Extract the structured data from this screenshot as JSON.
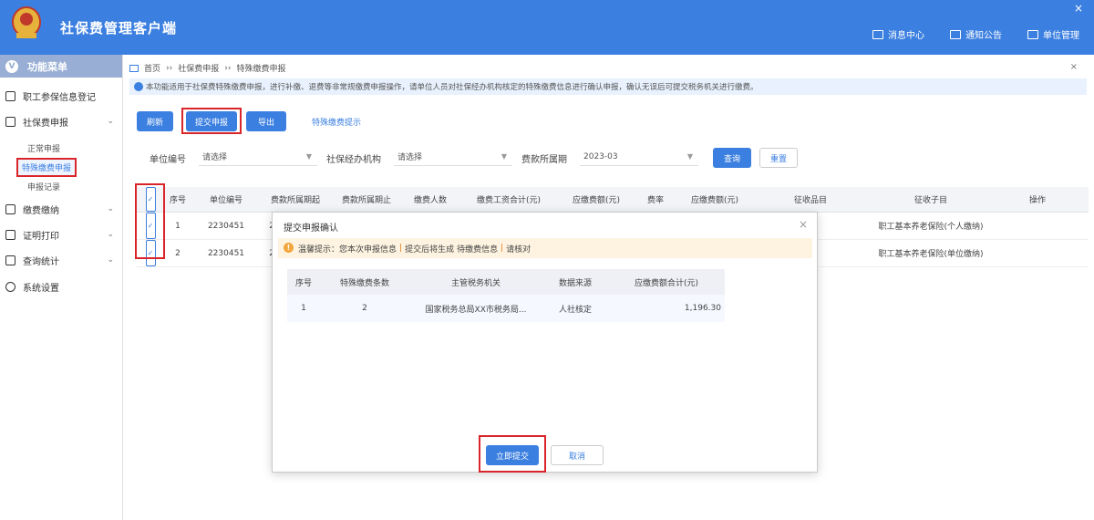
{
  "header": {
    "app_title": "社保费管理客户端",
    "actions": [
      {
        "label": "消息中心",
        "icon": "bell-icon"
      },
      {
        "label": "通知公告",
        "icon": "notice-icon"
      },
      {
        "label": "单位管理",
        "icon": "building-icon"
      }
    ],
    "close_symbol": "×"
  },
  "sidebar": {
    "title": "功能菜单",
    "items": [
      {
        "label": "职工参保信息登记",
        "icon": "register-icon"
      },
      {
        "label": "社保费申报",
        "icon": "declare-icon",
        "expanded": true
      },
      {
        "label": "缴费缴纳",
        "icon": "pay-icon"
      },
      {
        "label": "证明打印",
        "icon": "print-icon"
      },
      {
        "label": "查询统计",
        "icon": "stats-icon"
      },
      {
        "label": "系统设置",
        "icon": "gear-icon"
      }
    ],
    "sub_items": [
      "正常申报",
      "特殊缴费申报",
      "申报记录"
    ],
    "active_sub": "特殊缴费申报"
  },
  "breadcrumb": {
    "home": "首页",
    "level1": "社保费申报",
    "level2": "特殊缴费申报"
  },
  "notice_text": "本功能适用于社保费特殊缴费申报，进行补缴、退费等非常规缴费申报操作，请单位人员对社保经办机构核定的特殊缴费信息进行确认申报，确认无误后可提交税务机关进行缴费。",
  "toolbar": {
    "refresh_label": "刷新",
    "batch_label": "提交申报",
    "export_label": "导出",
    "link_label": "特殊缴费提示"
  },
  "filters": {
    "unit_label": "单位编号",
    "unit_value": "请选择",
    "agency_label": "社保经办机构",
    "agency_value": "请选择",
    "period_label": "费款所属期",
    "period_value": "2023-03",
    "query_label": "查询",
    "reset_label": "重置"
  },
  "grid": {
    "headers": [
      "序号",
      "单位编号",
      "费款所属期起",
      "费款所属期止",
      "缴费人数",
      "缴费工资合计(元)",
      "应缴费额(元)",
      "费率",
      "应缴费额(元)",
      "征收品目",
      "征收子目",
      "操作"
    ],
    "rows": [
      {
        "index": "1",
        "unit_no": "2230451",
        "unit_tail": "20",
        "item": "职工基本养老保险(个人缴纳)"
      },
      {
        "index": "2",
        "unit_no": "2230451",
        "unit_tail": "20",
        "item": "职工基本养老保险(单位缴纳)"
      }
    ]
  },
  "modal": {
    "title": "提交申报确认",
    "close_symbol": "×",
    "warning_prefix": "温馨提示：您本次申报信息",
    "warning_mid": "提交后将生成",
    "warning_mid2": "待缴费信息",
    "warning_end": "请核对",
    "table_headers": [
      "序号",
      "特殊缴费条数",
      "主管税务机关",
      "数据来源",
      "应缴费额合计(元)"
    ],
    "table_rows": [
      {
        "index": "1",
        "count": "2",
        "tax_office": "国家税务总局XX市税务局...",
        "source": "人社核定",
        "amount": "1,196.30"
      }
    ],
    "confirm_label": "立即提交",
    "cancel_label": "取消"
  },
  "colors": {
    "primary": "#3b7fe0",
    "highlight": "#d9252a",
    "warning": "#f2a63c"
  }
}
